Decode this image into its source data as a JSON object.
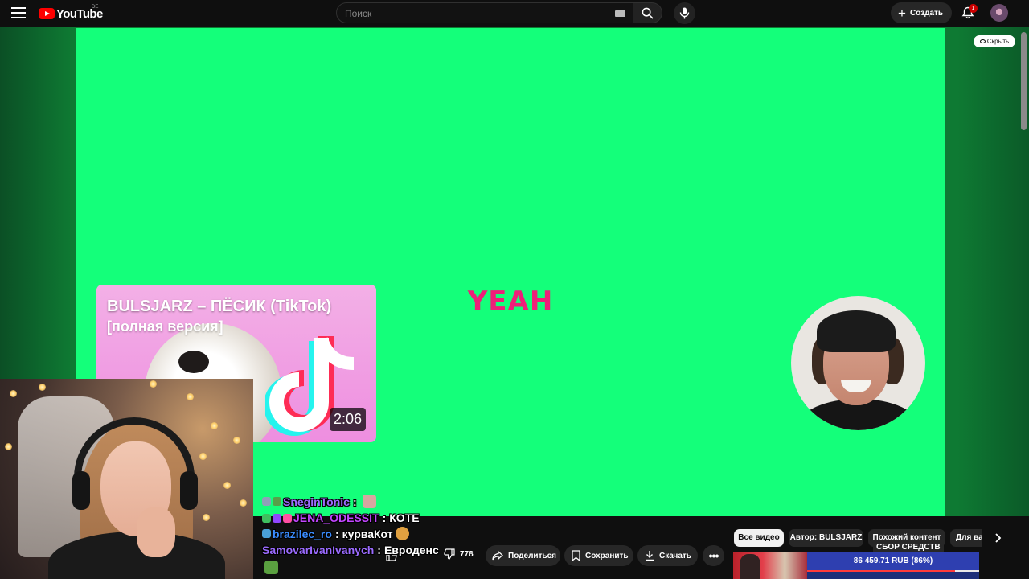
{
  "header": {
    "logo_text": "YouTube",
    "region": "DE",
    "search_placeholder": "Поиск",
    "create_label": "Создать",
    "notification_count": "1"
  },
  "player": {
    "center_text": "YEAH",
    "hide_label": "Скрыть",
    "background_color": "#14ff7a",
    "text_color": "#ef1f79"
  },
  "endscreen_card": {
    "title": "BULSJARZ – ПЁСИК (TikTok)",
    "subtitle": "[полная версия]",
    "duration": "2:06"
  },
  "actions": {
    "like_count": "778",
    "share_label": "Поделиться",
    "save_label": "Сохранить",
    "download_label": "Скачать"
  },
  "filters": [
    {
      "label": "Все видео",
      "active": true
    },
    {
      "label": "Автор: BULSJARZ",
      "active": false
    },
    {
      "label": "Похожий контент",
      "active": false
    },
    {
      "label": "Для вас",
      "active": false
    }
  ],
  "recommendation": {
    "fundraiser_label": "СБОР СРЕДСТВ",
    "fundraiser_amount": "86 459.71 RUB (86%)",
    "fundraiser_progress": 0.86
  },
  "chat": [
    {
      "user": "SneginTonic",
      "user_color": "#9b6bff",
      "message": ""
    },
    {
      "user": "JENA_ODESSIT",
      "user_color": "#c246ff",
      "message": "КОТЕ"
    },
    {
      "user": "brazilec_ro",
      "user_color": "#3a8cff",
      "message": "курваКот"
    },
    {
      "user": "SamovarIvanIvanych",
      "user_color": "#9b6bff",
      "message": "Евроденс"
    }
  ]
}
